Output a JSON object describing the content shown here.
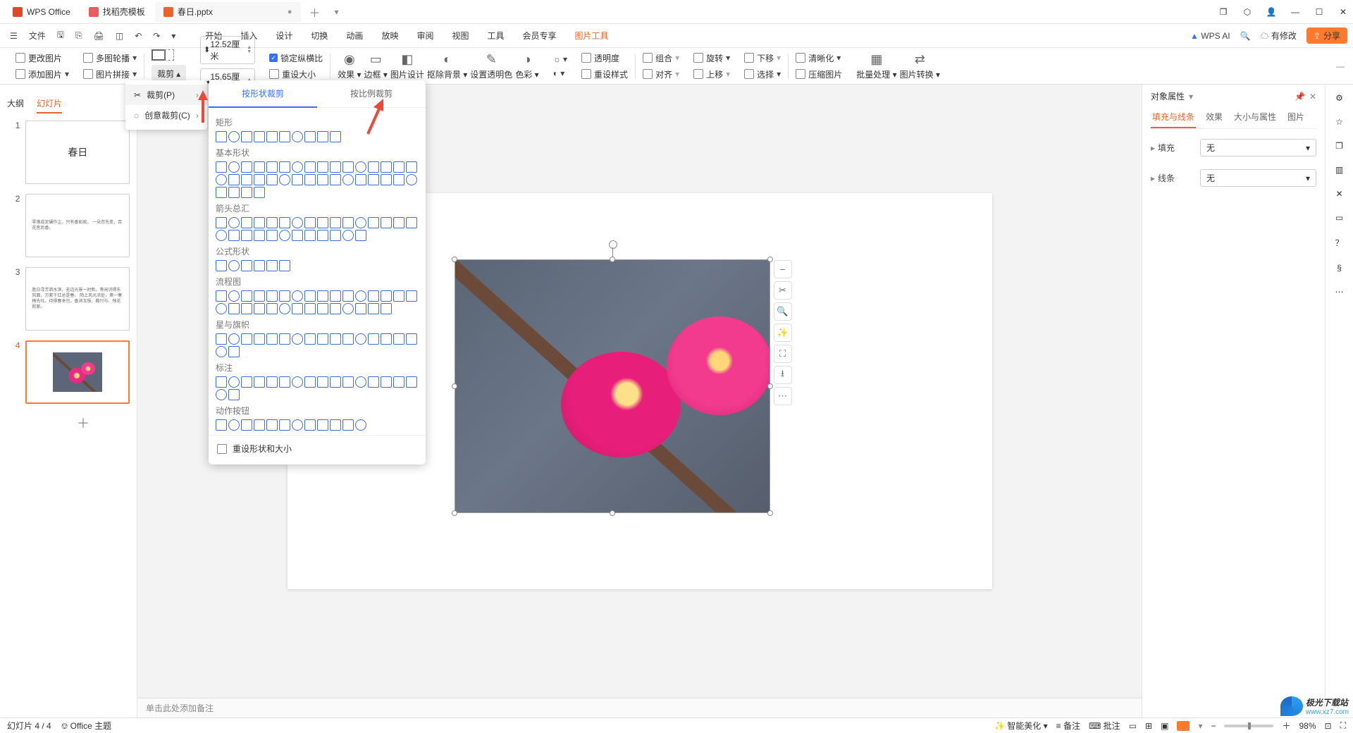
{
  "titlebar": {
    "tabs": [
      {
        "label": "WPS Office",
        "kind": "app"
      },
      {
        "label": "找稻壳模板",
        "kind": "docer"
      },
      {
        "label": "春日.pptx",
        "kind": "file"
      }
    ]
  },
  "menubar": {
    "file": "文件",
    "tabs": [
      "开始",
      "插入",
      "设计",
      "切换",
      "动画",
      "放映",
      "审阅",
      "视图",
      "工具",
      "会员专享",
      "图片工具"
    ],
    "ai": "WPS AI",
    "modified": "有修改",
    "share": "分享"
  },
  "ribbon": {
    "change_pic": "更改图片",
    "multi_layout": "多图轮播",
    "add_pic": "添加图片",
    "pic_join": "图片拼接",
    "crop": "裁剪",
    "w": "12.52厘米",
    "h": "15.65厘米",
    "lock_ratio": "锁定纵横比",
    "reset_size": "重设大小",
    "effects": "效果",
    "border": "边框",
    "pic_design": "图片设计",
    "remove_bg": "抠除背景",
    "set_trans": "设置透明色",
    "color": "色彩",
    "trans": "透明度",
    "set_style": "重设样式",
    "combine": "组合",
    "rotate": "旋转",
    "forward": "上移",
    "align": "对齐",
    "backward": "下移",
    "select": "选择",
    "clarify": "清晰化",
    "compress": "压缩图片",
    "batch": "批量处理",
    "convert": "图片转换"
  },
  "nav": {
    "outline": "大纲",
    "slides": "幻灯片"
  },
  "slides": {
    "titles": [
      "春日",
      "",
      "",
      ""
    ],
    "slide2_text": "零落成泥碾作尘，只有香如故。 一朵忽先变，百花皆后香。",
    "slide3_text": "胜日寻芳泗水滨，无边光景一时新。等闲识得东风面，万紫千红总是春。 陌上风光浓处，第一寒梅先吐。待得春来也，香消玉殒，都付与、残花败絮。"
  },
  "popup_crop": {
    "crop": "裁剪(P)",
    "creative": "创意裁剪(C)"
  },
  "shape_panel": {
    "tab1": "按形状裁剪",
    "tab2": "按比例裁剪",
    "groups": [
      "矩形",
      "基本形状",
      "箭头总汇",
      "公式形状",
      "流程图",
      "星与旗帜",
      "标注",
      "动作按钮"
    ],
    "reset": "重设形状和大小"
  },
  "right_panel": {
    "title": "对象属性",
    "tabs": [
      "填充与线条",
      "效果",
      "大小与属性",
      "图片"
    ],
    "fill": "填充",
    "line": "线条",
    "none": "无"
  },
  "notes_placeholder": "单击此处添加备注",
  "status": {
    "slide_of": "幻灯片 4 / 4",
    "theme": "Office 主题",
    "beautify": "智能美化",
    "notes": "备注",
    "comment": "批注",
    "zoom": "98%"
  },
  "watermark": {
    "name": "极光下载站",
    "url": "www.xz7.com"
  }
}
